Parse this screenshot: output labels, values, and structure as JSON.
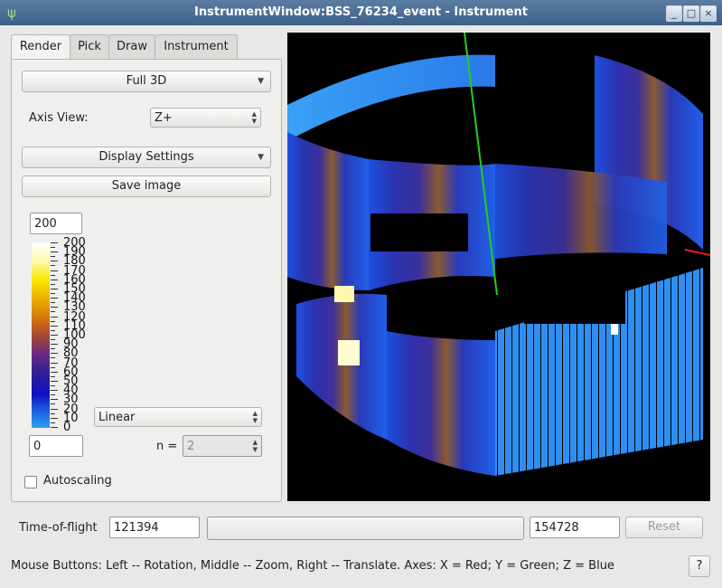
{
  "window": {
    "title": "InstrumentWindow:BSS_76234_event - Instrument",
    "buttons": [
      "_",
      "□",
      "×"
    ]
  },
  "tabs": [
    "Render",
    "Pick",
    "Draw",
    "Instrument"
  ],
  "render": {
    "mode_select": "Full 3D",
    "axis_view_label": "Axis View:",
    "axis_view_value": "Z+",
    "display_settings": "Display Settings",
    "save_image": "Save image"
  },
  "colormap": {
    "max": "200",
    "min": "0",
    "scale_type": "Linear",
    "n_label": "n =",
    "n_value": "2",
    "ticks": [
      "200",
      "190",
      "180",
      "170",
      "160",
      "150",
      "140",
      "130",
      "120",
      "110",
      "100",
      "90",
      "80",
      "70",
      "60",
      "50",
      "40",
      "30",
      "20",
      "10",
      "0"
    ],
    "autoscaling_label": "Autoscaling",
    "autoscaling_checked": false
  },
  "tof": {
    "label": "Time-of-flight",
    "min": "121394",
    "max": "154728",
    "reset": "Reset"
  },
  "status": "Mouse Buttons: Left -- Rotation, Middle -- Zoom, Right -- Translate. Axes: X = Red; Y = Green; Z = Blue",
  "help": "?"
}
